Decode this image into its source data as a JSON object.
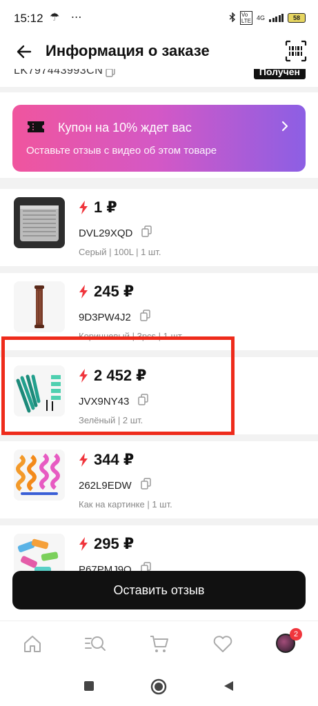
{
  "status_bar": {
    "time": "15:12",
    "left_icons": "☂ ⋯",
    "battery": "58",
    "network": "4G"
  },
  "header": {
    "title": "Информация о заказе"
  },
  "order": {
    "tracking_number": "LK797443993CN",
    "status": "Получен"
  },
  "coupon": {
    "title": "Купон на 10% ждет вас",
    "subtitle": "Оставьте отзыв с видео об этом товаре"
  },
  "products": [
    {
      "price": "1 ₽",
      "sku": "DVL29XQD",
      "variant": "Серый | 100L | 1 шт."
    },
    {
      "price": "245 ₽",
      "sku": "9D3PW4J2",
      "variant": "Коричневый | 3pcs | 1 шт."
    },
    {
      "price": "2 452 ₽",
      "sku": "JVX9NY43",
      "variant": "Зелёный | 2 шт."
    },
    {
      "price": "344 ₽",
      "sku": "262L9EDW",
      "variant": "Как на картинке | 1 шт."
    },
    {
      "price": "295 ₽",
      "sku": "P67PMJ9Q",
      "variant": ""
    }
  ],
  "review_button": "Оставить отзыв",
  "bottom_nav": {
    "items": [
      "home-icon",
      "catalog-search-icon",
      "cart-icon",
      "heart-icon",
      "profile-avatar"
    ],
    "profile_badge": "2"
  },
  "colors": {
    "accent": "#f0363d",
    "coupon_gradient_start": "#f0559e",
    "coupon_gradient_end": "#8c5fe4",
    "highlight": "#ee2b1b"
  }
}
